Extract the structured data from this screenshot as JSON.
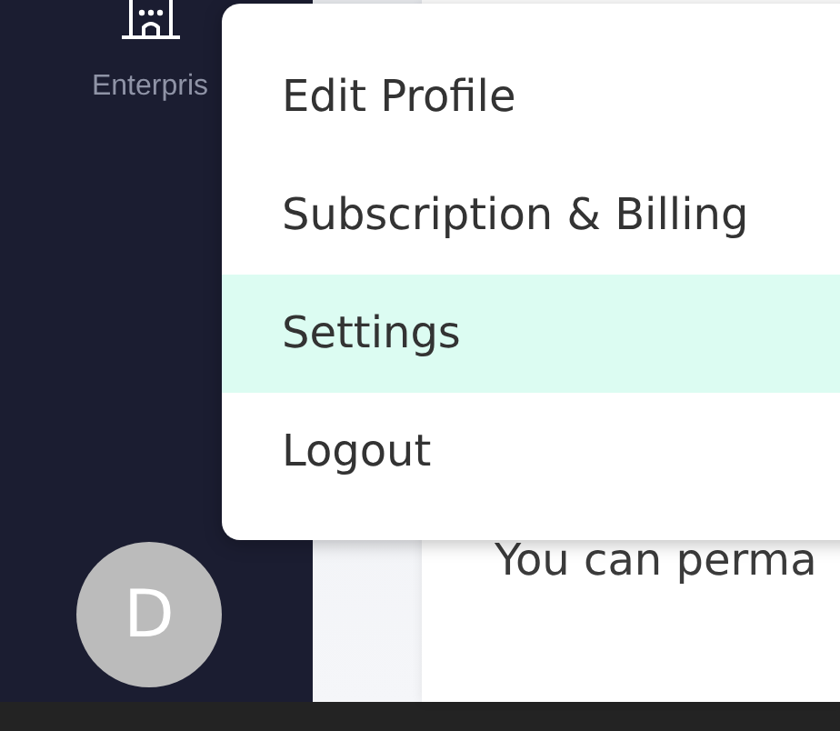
{
  "sidebar": {
    "items": [
      {
        "label": "Enterpris"
      }
    ],
    "avatar": {
      "initial": "D"
    }
  },
  "main": {
    "text": "You can perma"
  },
  "menu": {
    "items": [
      {
        "label": "Edit Profile",
        "selected": false
      },
      {
        "label": "Subscription & Billing",
        "selected": false
      },
      {
        "label": "Settings",
        "selected": true
      },
      {
        "label": "Logout",
        "selected": false
      }
    ]
  }
}
